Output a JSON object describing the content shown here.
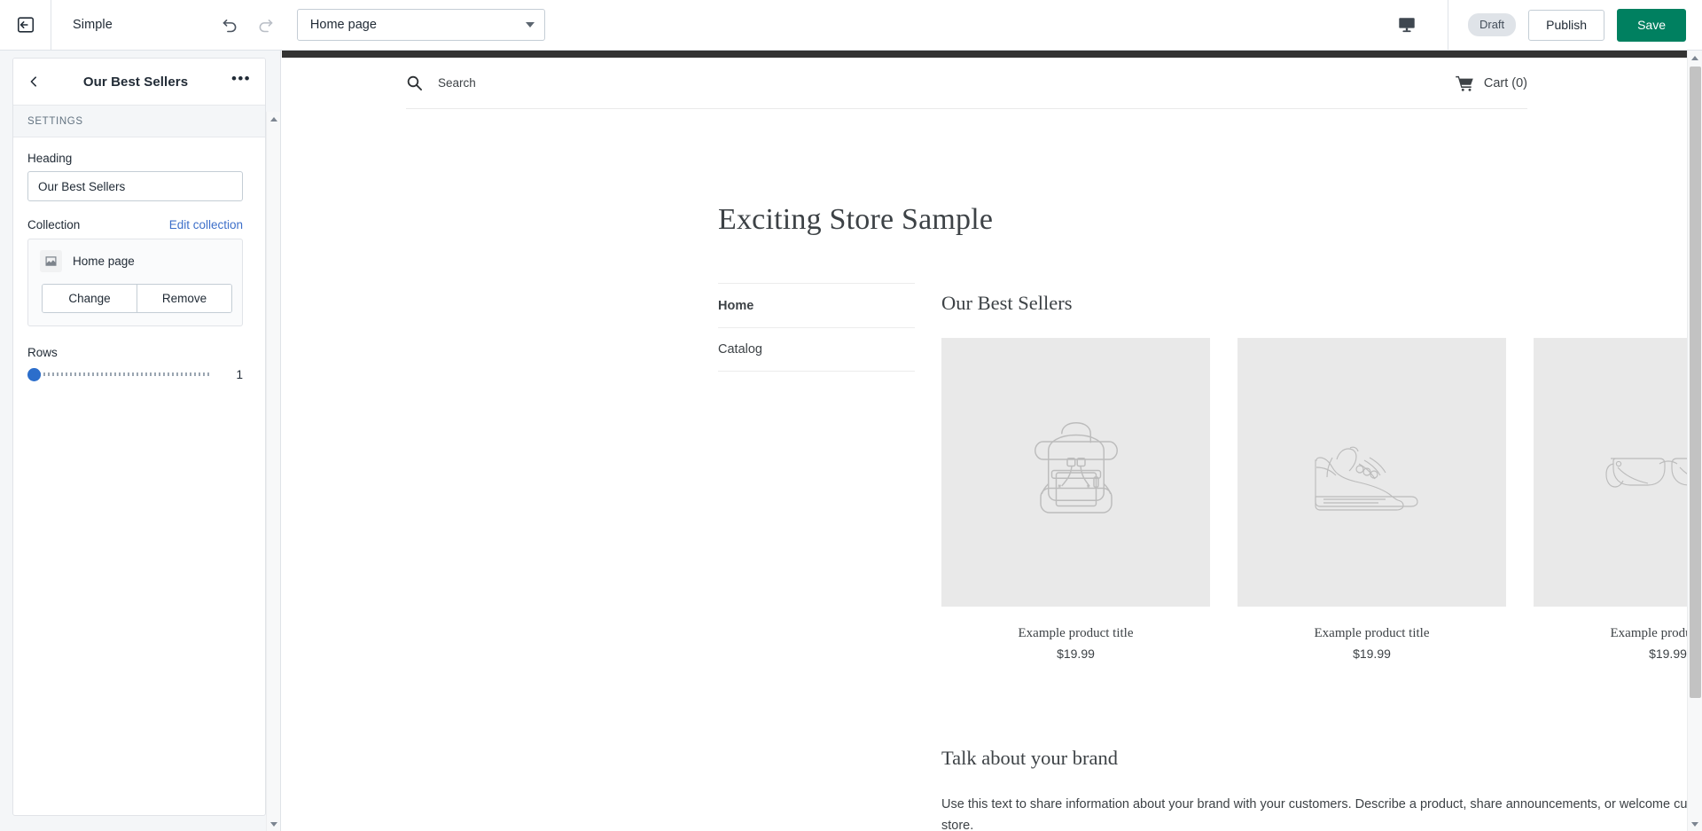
{
  "topbar": {
    "exit_icon": "exit-arrow-icon",
    "theme_name": "Simple",
    "undo_icon": "undo-icon",
    "redo_icon": "redo-icon",
    "page_selector": {
      "value": "Home page",
      "caret_icon": "chevron-down-icon"
    },
    "device_icon": "desktop-monitor-icon",
    "draft_badge": "Draft",
    "publish_label": "Publish",
    "save_label": "Save",
    "save_color": "#008060"
  },
  "sidebar": {
    "back_icon": "chevron-left-icon",
    "title": "Our Best Sellers",
    "more_icon": "ellipsis-icon",
    "more_glyph": "•••",
    "section_label": "SETTINGS",
    "heading_field": {
      "label": "Heading",
      "value": "Our Best Sellers"
    },
    "collection": {
      "label": "Collection",
      "edit_link": "Edit collection",
      "edit_link_color": "#3d6fc9",
      "item_icon": "image-placeholder-icon",
      "item_name": "Home page",
      "change_label": "Change",
      "remove_label": "Remove"
    },
    "rows": {
      "label": "Rows",
      "value": "1",
      "thumb_color": "#2c6ecb"
    }
  },
  "preview": {
    "announcement_bar_color": "#333333",
    "search": {
      "icon": "search-icon",
      "label": "Search"
    },
    "cart": {
      "icon": "shopping-cart-icon",
      "label": "Cart (0)"
    },
    "store_title": "Exciting Store Sample",
    "nav": [
      {
        "label": "Home",
        "active": true
      },
      {
        "label": "Catalog",
        "active": false
      }
    ],
    "section_heading": "Our Best Sellers",
    "products": [
      {
        "icon": "backpack-icon",
        "title": "Example product title",
        "price": "$19.99"
      },
      {
        "icon": "sneaker-icon",
        "title": "Example product title",
        "price": "$19.99"
      },
      {
        "icon": "eyeglasses-icon",
        "title": "Example product title",
        "price": "$19.99"
      }
    ],
    "brand": {
      "heading": "Talk about your brand",
      "text": "Use this text to share information about your brand with your customers. Describe a product, share announcements, or welcome customers to your store."
    }
  }
}
